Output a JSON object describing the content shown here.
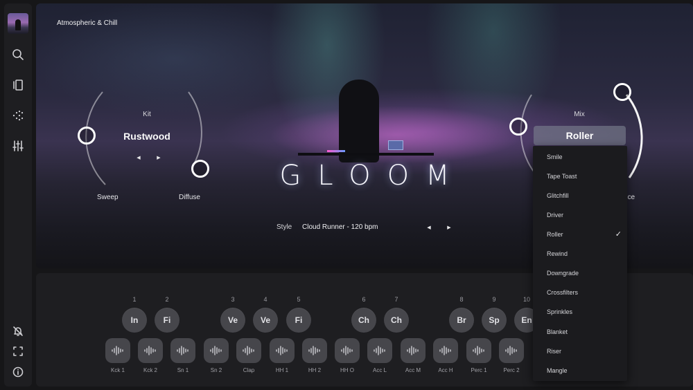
{
  "hero": {
    "title": "Atmospheric & Chill",
    "brand": "GLOOM",
    "kit_label": "Kit",
    "kit_name": "Rustwood",
    "sweep_label": "Sweep",
    "diffuse_label": "Diffuse",
    "mix_label": "Mix",
    "ambience_label_partial": "nce",
    "style_label": "Style",
    "style_value": "Cloud Runner - 120 bpm",
    "prev_glyph": "◀",
    "next_glyph": "▶"
  },
  "mix_dropdown": {
    "selected": "Roller",
    "options": [
      "Smile",
      "Tape Toast",
      "Glitchfill",
      "Driver",
      "Roller",
      "Rewind",
      "Downgrade",
      "Crossfilters",
      "Sprinkles",
      "Blanket",
      "Riser",
      "Mangle"
    ],
    "check_glyph": "✓"
  },
  "sidebar": {
    "icons": [
      "search-icon",
      "browser-icon",
      "dots-icon",
      "mixer-sliders-icon"
    ],
    "bottom_icons": [
      "notifications-off-icon",
      "fullscreen-icon",
      "info-icon"
    ]
  },
  "pads": {
    "numbers": [
      "1",
      "2",
      "3",
      "4",
      "5",
      "6",
      "7",
      "8",
      "9",
      "10"
    ],
    "labels": [
      "In",
      "Fi",
      "Ve",
      "Ve",
      "Fi",
      "Ch",
      "Ch",
      "Br",
      "Sp",
      "En"
    ]
  },
  "samples": [
    "Kck 1",
    "Kck 2",
    "Sn 1",
    "Sn 2",
    "Clap",
    "HH 1",
    "HH 2",
    "HH O",
    "Acc L",
    "Acc M",
    "Acc H",
    "Perc 1",
    "Perc 2"
  ],
  "colors": {
    "accent": "#ffffff",
    "panel": "#1e1e21",
    "pad": "#46464b"
  }
}
